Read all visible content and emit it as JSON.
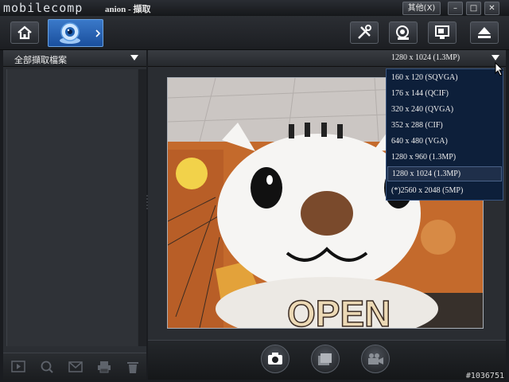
{
  "window": {
    "logo_text": "mobilecomp",
    "title": "anion - 擷取",
    "close_menu_label": "其他(X)",
    "min_glyph": "–",
    "max_glyph": "□",
    "close_glyph": "✕"
  },
  "toolbar": {
    "home": "home-icon",
    "capture": "webcam-icon",
    "settings": "tools-icon",
    "effects": "webcam-settings-icon",
    "screen": "monitor-icon",
    "eject": "eject-icon"
  },
  "sidebar": {
    "title": "全部擷取檔案",
    "footer_icons": [
      "slideshow-icon",
      "search-icon",
      "email-icon",
      "print-icon",
      "trash-icon"
    ]
  },
  "main": {
    "resolution_selected": "1280 x 1024 (1.3MP)",
    "resolutions": [
      "160 x 120 (SQVGA)",
      "176 x 144 (QCIF)",
      "320 x 240 (QVGA)",
      "352 x 288 (CIF)",
      "640 x 480 (VGA)",
      "1280 x 960 (1.3MP)",
      "1280 x 1024 (1.3MP)",
      "(*)2560 x 2048 (5MP)"
    ],
    "selected_index": 6,
    "preview_text": "OPEN",
    "actions": [
      "camera-icon",
      "multi-shot-icon",
      "video-icon"
    ]
  },
  "watermark": "#1036751"
}
